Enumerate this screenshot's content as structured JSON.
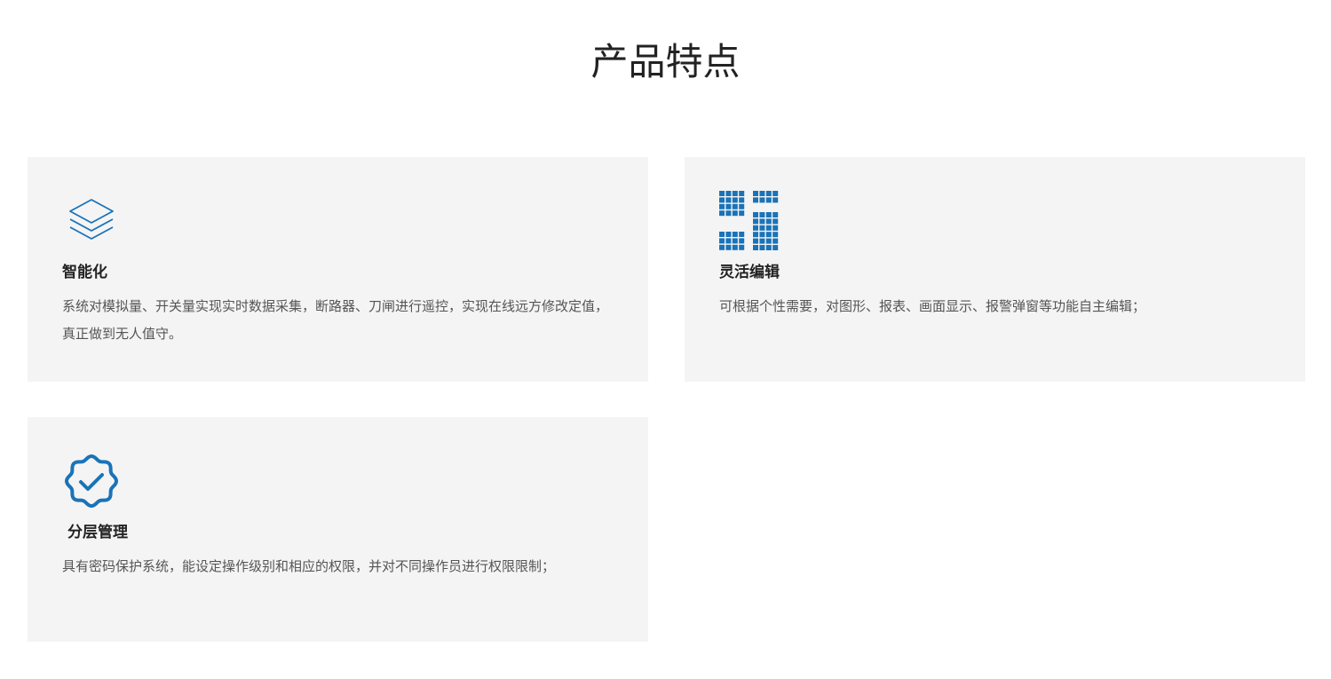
{
  "page": {
    "title": "产品特点"
  },
  "colors": {
    "accent": "#1a73b8",
    "card_bg": "#f4f4f4",
    "title_text": "#222222",
    "body_text": "#555555"
  },
  "features": [
    {
      "icon": "layers-icon",
      "title": "智能化",
      "description": "系统对模拟量、开关量实现实时数据采集，断路器、刀闸进行遥控，实现在线远方修改定值，真正做到无人值守。"
    },
    {
      "icon": "grid-modules-icon",
      "title": "灵活编辑",
      "description": "可根据个性需要，对图形、报表、画面显示、报警弹窗等功能自主编辑；"
    },
    {
      "icon": "verified-badge-icon",
      "title": "分层管理",
      "description": "具有密码保护系统，能设定操作级别和相应的权限，并对不同操作员进行权限限制；"
    }
  ]
}
